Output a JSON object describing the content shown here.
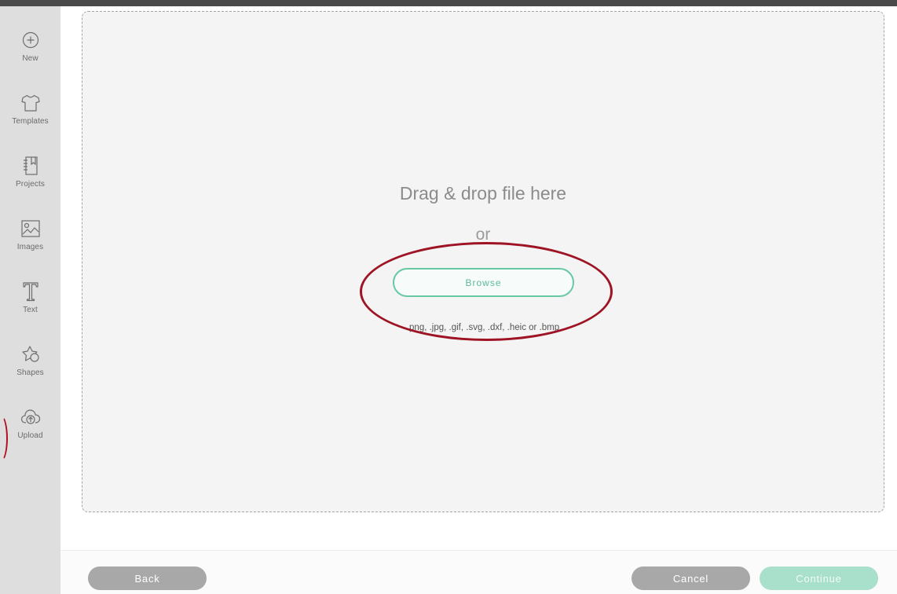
{
  "sidebar": {
    "items": [
      {
        "label": "New",
        "icon": "plus-circle-icon"
      },
      {
        "label": "Templates",
        "icon": "shirt-icon"
      },
      {
        "label": "Projects",
        "icon": "notebook-icon"
      },
      {
        "label": "Images",
        "icon": "image-icon"
      },
      {
        "label": "Text",
        "icon": "text-t-icon"
      },
      {
        "label": "Shapes",
        "icon": "shapes-icon"
      },
      {
        "label": "Upload",
        "icon": "cloud-upload-icon"
      }
    ]
  },
  "dropzone": {
    "title": "Drag & drop file here",
    "or": "or",
    "browse_label": "Browse",
    "formats": ".png, .jpg, .gif, .svg, .dxf, .heic or .bmp"
  },
  "footer": {
    "back_label": "Back",
    "cancel_label": "Cancel",
    "continue_label": "Continue"
  },
  "colors": {
    "accent": "#66c9a4",
    "highlight": "#9e1424",
    "button_gray": "#a8a8a8"
  }
}
